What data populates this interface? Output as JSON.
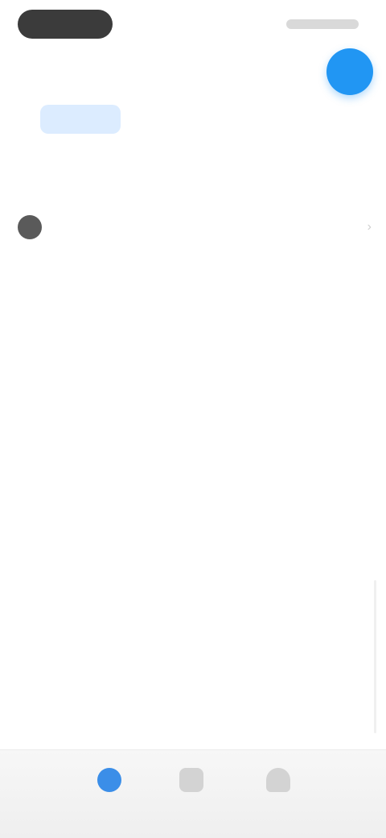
{
  "nav": {
    "title": "",
    "back": ""
  },
  "tabs": [
    {
      "label": "",
      "active": false
    },
    {
      "label": "",
      "active": true
    },
    {
      "label": "",
      "active": false
    },
    {
      "label": "",
      "active": false
    }
  ],
  "sections": {
    "s1": {
      "title": "",
      "row_label": ""
    },
    "s2": {
      "title": "",
      "edit": "",
      "rows": [
        {
          "k": "",
          "v": ""
        },
        {
          "k": "",
          "v": ""
        }
      ]
    },
    "s3": {
      "title": "",
      "rows": [
        {
          "k": "",
          "v": ""
        },
        {
          "k": "",
          "v": ""
        },
        {
          "k": "",
          "v": ""
        }
      ]
    }
  },
  "bottom_nav": [
    {
      "label": "",
      "icon": "home-icon",
      "active": true
    },
    {
      "label": "",
      "icon": "wallet-icon",
      "active": false
    },
    {
      "label": "",
      "icon": "profile-icon",
      "active": false
    }
  ],
  "colors": {
    "accent": "#2196f3",
    "tab_active_bg": "#dcecff"
  }
}
